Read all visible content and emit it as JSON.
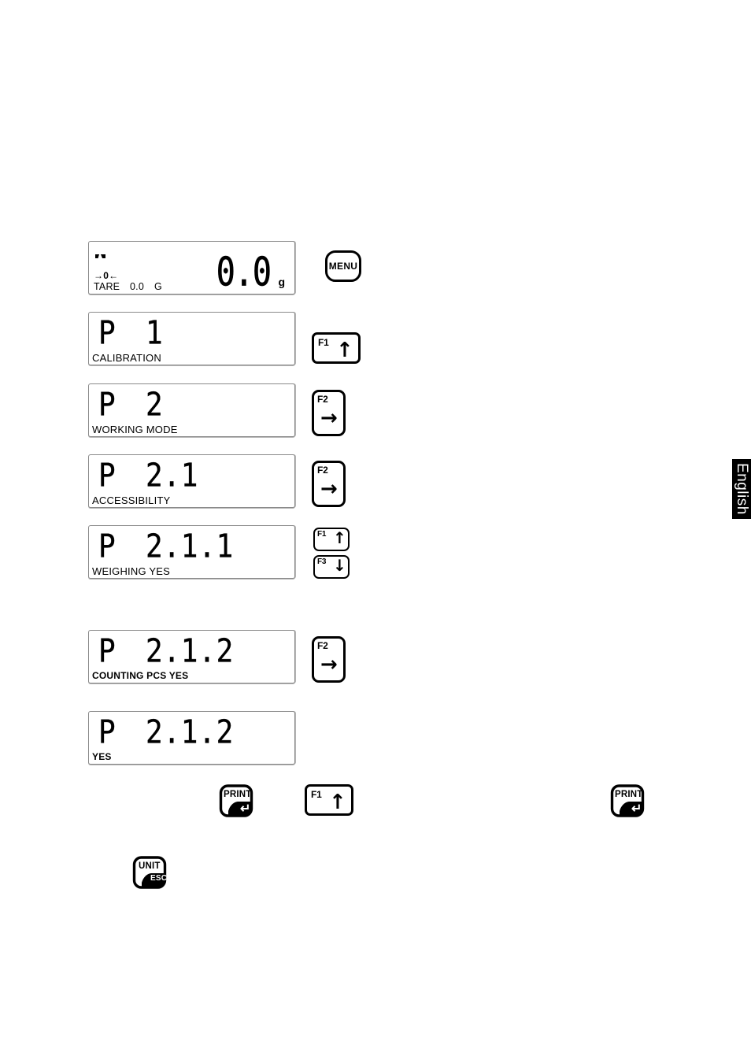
{
  "page": {
    "language_tab": "English"
  },
  "displays": [
    {
      "id": "weighing-display",
      "stability_indicator": "stability-icon",
      "zero_indicator": "→0←",
      "tare_label": "TARE",
      "tare_value": "0.0",
      "tare_unit": "G",
      "weight_value": "0.0",
      "weight_unit": "g"
    },
    {
      "id": "p1-display",
      "prefix": "P",
      "code": "1",
      "label": "CALIBRATION"
    },
    {
      "id": "p2-display",
      "prefix": "P",
      "code": "2",
      "label": "WORKING MODE"
    },
    {
      "id": "p21-display",
      "prefix": "P",
      "code": "2.1",
      "label": "ACCESSIBILITY"
    },
    {
      "id": "p211-display",
      "prefix": "P",
      "code": "2.1.1",
      "label": "WEIGHING YES"
    },
    {
      "id": "p212-display",
      "prefix": "P",
      "code": "2.1.2",
      "label": "COUNTING  PCS YES"
    },
    {
      "id": "p212-yes-display",
      "prefix": "P",
      "code": "2.1.2",
      "label": "YES"
    }
  ],
  "keys": {
    "menu": {
      "label": "MENU",
      "icon": "menu-key-icon"
    },
    "f1_up": {
      "fn": "F1",
      "arrow": "↑",
      "icon": "arrow-up-icon"
    },
    "f2_right": {
      "fn": "F2",
      "arrow": "→",
      "icon": "arrow-right-icon"
    },
    "f3_down": {
      "fn": "F3",
      "arrow": "↓",
      "icon": "arrow-down-icon"
    },
    "print": {
      "label": "PRINT",
      "sub": "↵",
      "icon": "enter-icon"
    },
    "unit": {
      "label": "UNIT",
      "sub": "ESC",
      "icon": "escape-icon"
    }
  },
  "colors": {
    "ink": "#000000",
    "lcd_border": "#8a8a8a",
    "background": "#ffffff",
    "tab_background": "#000000",
    "tab_text": "#ffffff"
  }
}
